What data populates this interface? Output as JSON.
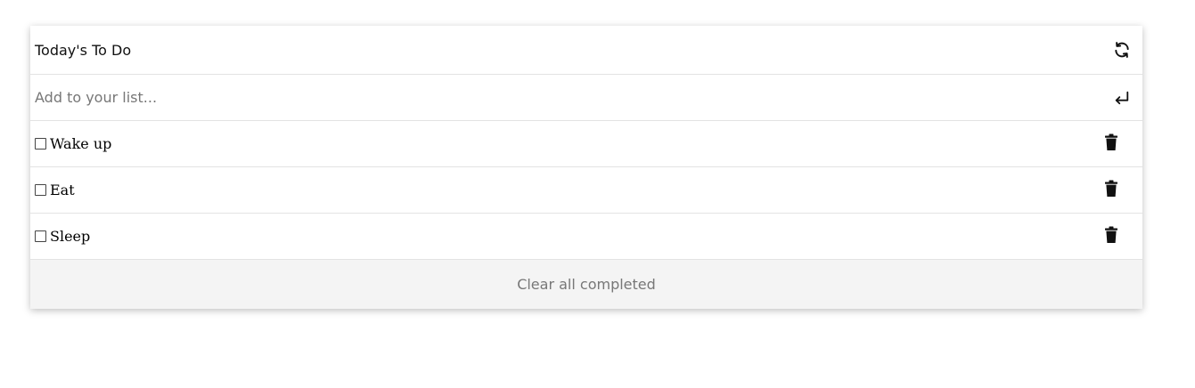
{
  "header": {
    "title": "Today's To Do",
    "refresh_icon": "refresh-icon"
  },
  "add": {
    "placeholder": "Add to your list...",
    "value": "",
    "enter_icon": "enter-return-icon"
  },
  "items": [
    {
      "label": "Wake up",
      "checked": false
    },
    {
      "label": "Eat",
      "checked": false
    },
    {
      "label": "Sleep",
      "checked": false
    }
  ],
  "footer": {
    "clear_label": "Clear all completed"
  },
  "colors": {
    "footer_bg": "#f4f4f4",
    "muted_text": "#777777",
    "divider": "#e3e3e3"
  }
}
